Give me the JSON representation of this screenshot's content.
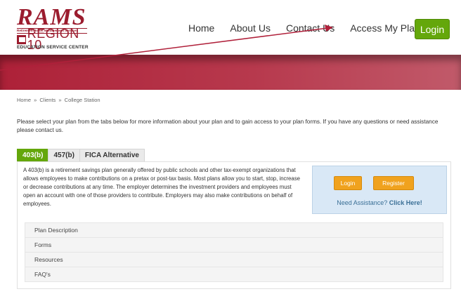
{
  "logo": {
    "brand": "RAMS",
    "tagline": "Retirement Asset Management Services",
    "region": "REGION 10",
    "center": "EDUCATION SERVICE CENTER"
  },
  "nav": {
    "items": [
      "Home",
      "About Us",
      "Contact Us",
      "Access My Plan"
    ],
    "login_label": "Login"
  },
  "breadcrumb": [
    "Home",
    "Clients",
    "College Station"
  ],
  "breadcrumb_sep": "»",
  "intro": "Please select your plan from the tabs below for more information about your plan and to gain access to your plan forms. If you have any questions or need assistance please contact us.",
  "tabs": [
    {
      "label": "403(b)",
      "active": true
    },
    {
      "label": "457(b)",
      "active": false
    },
    {
      "label": "FICA Alternative",
      "active": false
    }
  ],
  "panel": {
    "description": "A 403(b) is a retirement savings plan generally offered by public schools and other tax-exempt organizations that allows employees to make contributions on a pretax or post-tax basis. Most plans allow you to start, stop, increase or decrease contributions at any time. The employer determines the investment providers and employees must open an account with one of those providers to contribute. Employers may also make contributions on behalf of employees.",
    "assist": {
      "login_label": "Login",
      "register_label": "Register",
      "help_text": "Need Assistance?",
      "help_link": "Click Here!"
    },
    "accordion": [
      "Plan Description",
      "Forms",
      "Resources",
      "FAQ's"
    ]
  },
  "colors": {
    "brand_red": "#9b1c2e",
    "accent_green": "#64a70b",
    "button_orange": "#f0a21e",
    "assist_blue": "#d9e8f6"
  }
}
